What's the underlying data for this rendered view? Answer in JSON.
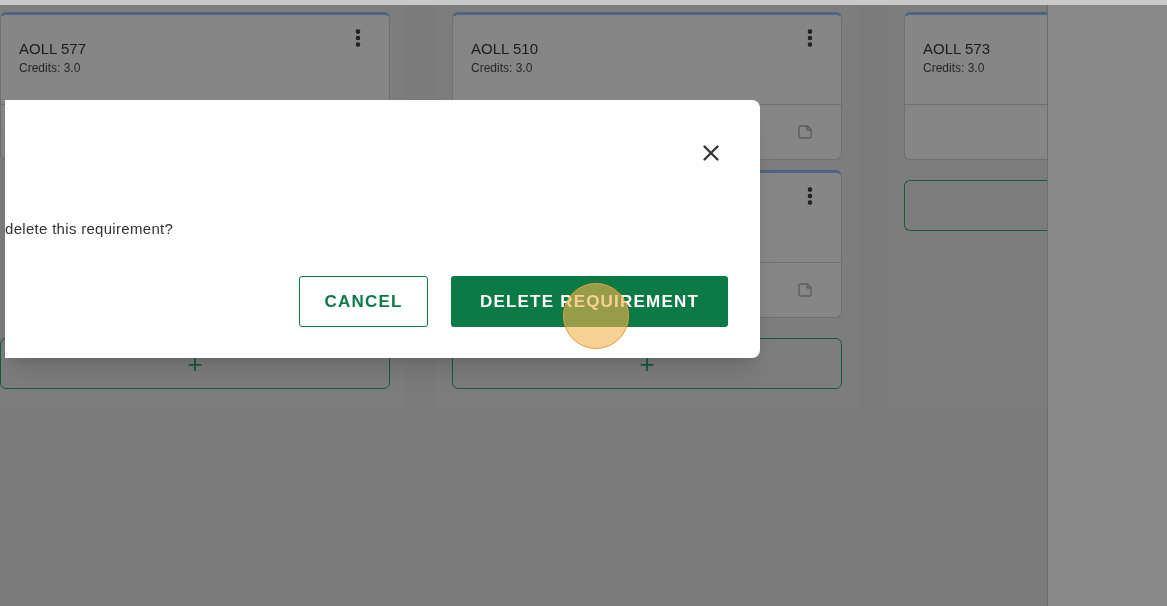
{
  "columns": [
    {
      "cut_off": false,
      "items": [
        {
          "kind": "card",
          "code": "AOLL 577",
          "credits": "Credits: 3.0"
        },
        {
          "kind": "covered"
        }
      ],
      "add_label": "+"
    },
    {
      "cut_off": false,
      "items": [
        {
          "kind": "card",
          "code": "AOLL 510",
          "credits": "Credits: 3.0",
          "note_icon": true
        },
        {
          "kind": "card",
          "note_icon": true
        }
      ],
      "add_label": "+"
    },
    {
      "cut_off": true,
      "items": [
        {
          "kind": "card",
          "code": "AOLL 573",
          "credits": "Credits: 3.0"
        }
      ]
    }
  ],
  "dialog": {
    "message": "delete this requirement?",
    "buttons": [
      {
        "label": "CANCEL",
        "kind": "outline"
      },
      {
        "label": "DELETE REQUIREMENT",
        "kind": "primary"
      }
    ]
  }
}
